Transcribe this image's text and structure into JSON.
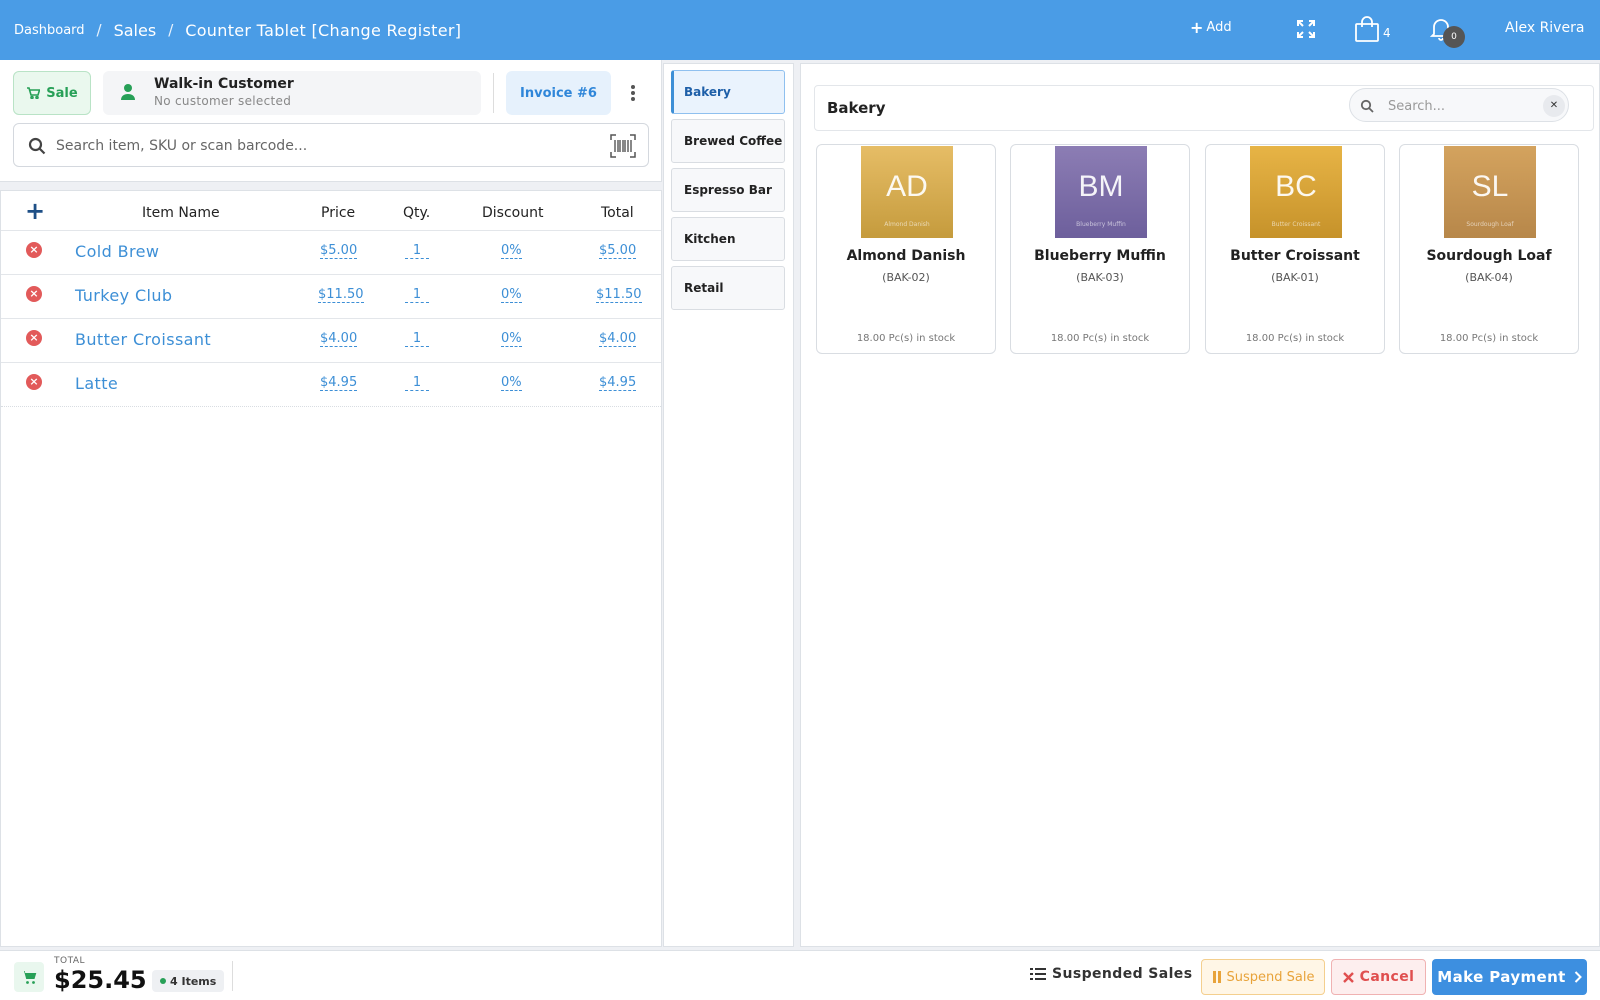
{
  "header": {
    "breadcrumb": [
      "Dashboard",
      "Sales",
      "Counter Tablet [Change Register]"
    ],
    "add_label": "Add",
    "cart_count": "4",
    "notification_count": "0",
    "user_name": "Alex Rivera",
    "accent_color": "#4a9ce6"
  },
  "customer": {
    "sale_label": "Sale",
    "name": "Walk-in Customer",
    "subtitle": "No customer selected",
    "invoice_label": "Invoice #6"
  },
  "item_search": {
    "placeholder": "Search item, SKU or scan barcode..."
  },
  "table": {
    "columns": [
      "Item Name",
      "Price",
      "Qty.",
      "Discount",
      "Total"
    ],
    "rows": [
      {
        "name": "Cold Brew",
        "price": "$5.00",
        "qty": "1",
        "discount": "0%",
        "total": "$5.00"
      },
      {
        "name": "Turkey Club",
        "price": "$11.50",
        "qty": "1",
        "discount": "0%",
        "total": "$11.50"
      },
      {
        "name": "Butter Croissant",
        "price": "$4.00",
        "qty": "1",
        "discount": "0%",
        "total": "$4.00"
      },
      {
        "name": "Latte",
        "price": "$4.95",
        "qty": "1",
        "discount": "0%",
        "total": "$4.95"
      }
    ]
  },
  "categories": [
    {
      "label": "Bakery",
      "active": true
    },
    {
      "label": "Brewed Coffee",
      "active": false
    },
    {
      "label": "Espresso Bar",
      "active": false
    },
    {
      "label": "Kitchen",
      "active": false
    },
    {
      "label": "Retail",
      "active": false
    }
  ],
  "products": {
    "title": "Bakery",
    "search_placeholder": "Search...",
    "items": [
      {
        "initials": "AD",
        "caption": "Almond Danish",
        "name": "Almond Danish",
        "sku": "(BAK-02)",
        "stock": "18.00 Pc(s) in stock",
        "color_top": "#e6bd66",
        "color_bottom": "#c59b3d"
      },
      {
        "initials": "BM",
        "caption": "Blueberry Muffin",
        "name": "Blueberry Muffin",
        "sku": "(BAK-03)",
        "stock": "18.00 Pc(s) in stock",
        "color_top": "#8c7db4",
        "color_bottom": "#6d5f9c"
      },
      {
        "initials": "BC",
        "caption": "Butter Croissant",
        "name": "Butter Croissant",
        "sku": "(BAK-01)",
        "stock": "18.00 Pc(s) in stock",
        "color_top": "#e7b446",
        "color_bottom": "#c6922a"
      },
      {
        "initials": "SL",
        "caption": "Sourdough Loaf",
        "name": "Sourdough Loaf",
        "sku": "(BAK-04)",
        "stock": "18.00 Pc(s) in stock",
        "color_top": "#d4a35e",
        "color_bottom": "#b7874a"
      }
    ]
  },
  "footer": {
    "total_label": "TOTAL",
    "total_value": "$25.45",
    "items_label": "4 Items",
    "suspended_sales_label": "Suspended Sales",
    "suspend_label": "Suspend Sale",
    "cancel_label": "Cancel",
    "pay_label": "Make Payment"
  }
}
